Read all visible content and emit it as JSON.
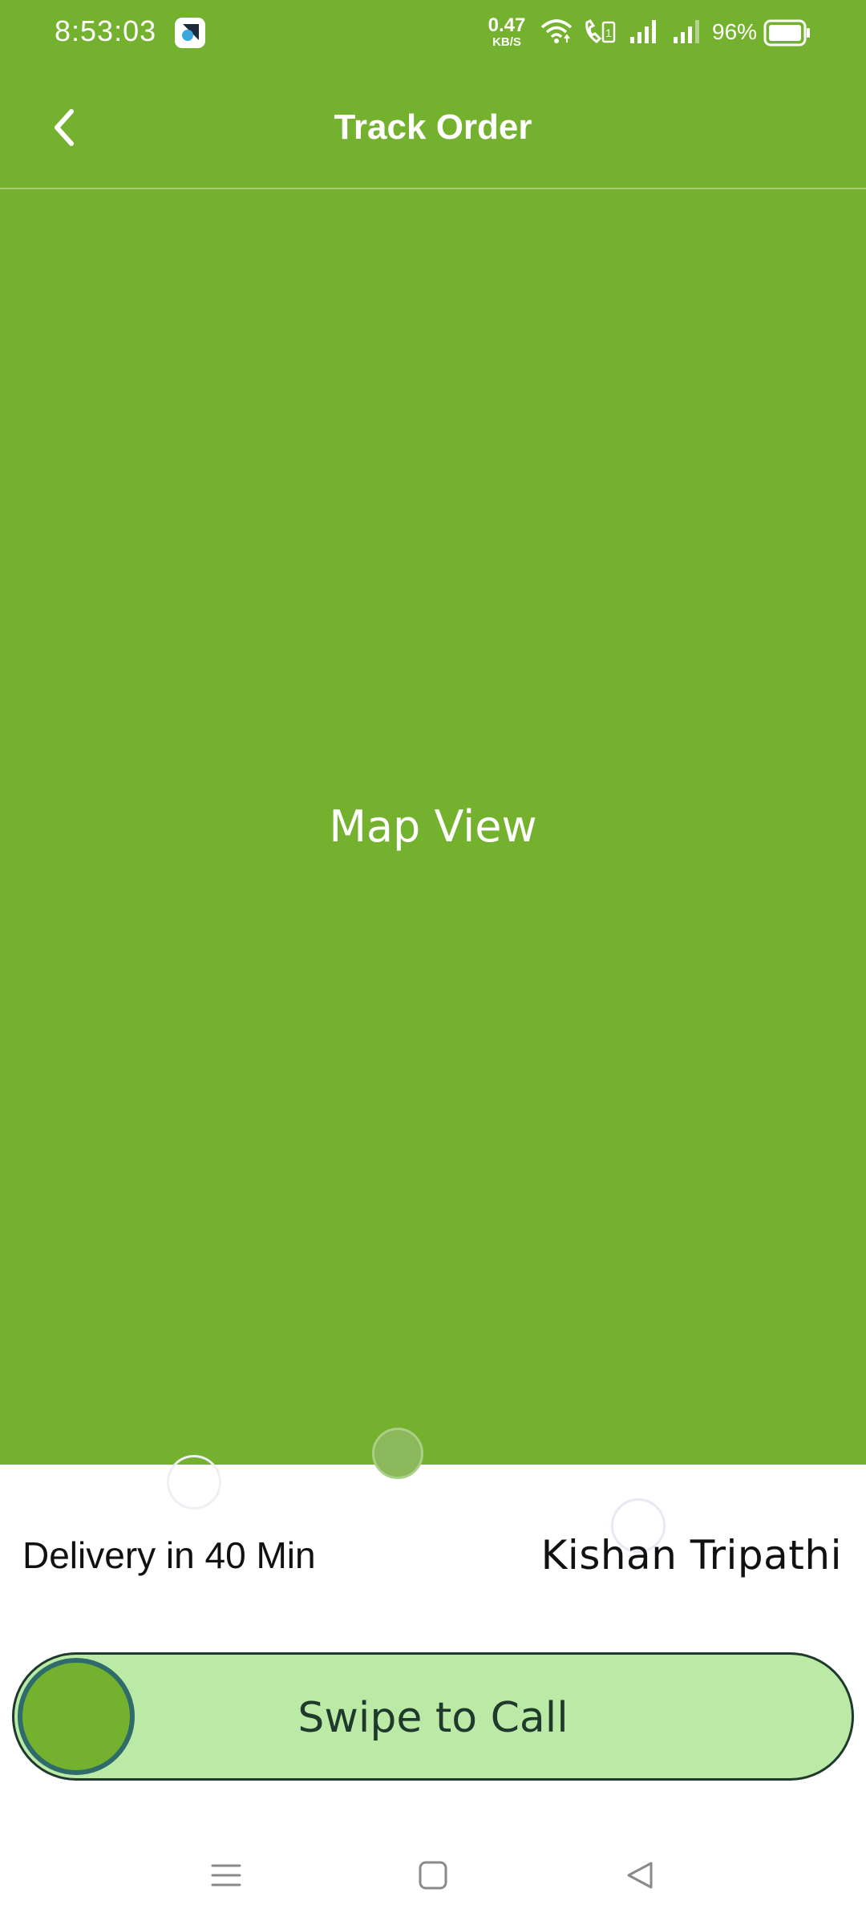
{
  "status_bar": {
    "time": "8:53:03",
    "net_speed_value": "0.47",
    "net_speed_unit": "KB/S",
    "battery": "96%"
  },
  "header": {
    "title": "Track Order",
    "back_icon": "chevron-left-icon"
  },
  "map": {
    "label": "Map View"
  },
  "delivery": {
    "eta_text": "Delivery in 40 Min",
    "driver_name": "Kishan Tripathi"
  },
  "swipe": {
    "label": "Swipe to Call"
  },
  "nav_bar": {
    "recents_icon": "menu-icon",
    "home_icon": "square-icon",
    "back_icon": "triangle-back-icon"
  },
  "colors": {
    "brand_green": "#74b12e",
    "swipe_track": "#bbeaa6",
    "swipe_border": "#1f3a2d",
    "handle_border": "#2f6b6a"
  }
}
